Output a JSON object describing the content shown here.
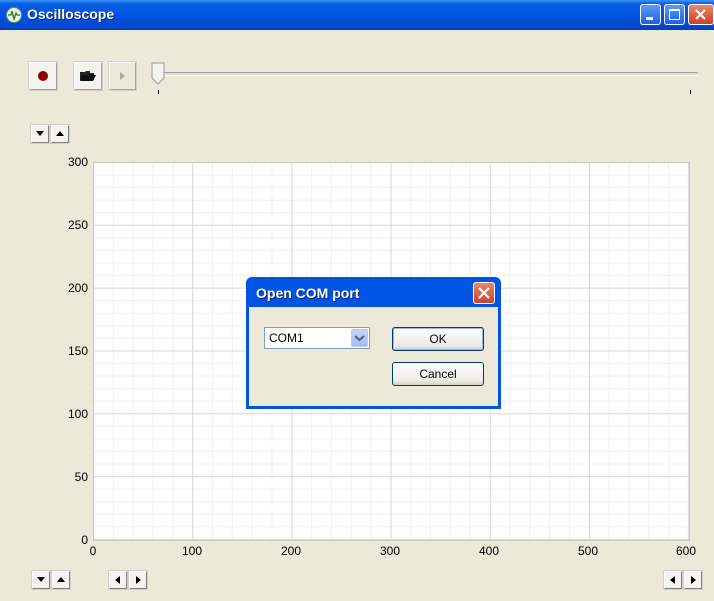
{
  "window": {
    "title": "Oscilloscope"
  },
  "toolbar": {
    "record_icon": "record-icon",
    "open_icon": "folder-open-icon",
    "play_icon": "play-icon",
    "slider_value": 0
  },
  "plot": {
    "y_ticks": [
      "300",
      "250",
      "200",
      "150",
      "100",
      "50",
      "0"
    ],
    "x_ticks": [
      "0",
      "100",
      "200",
      "300",
      "400",
      "500",
      "600"
    ]
  },
  "dialog": {
    "title": "Open COM port",
    "port_value": "COM1",
    "ok_label": "OK",
    "cancel_label": "Cancel"
  },
  "colors": {
    "titlebar": "#0054e3",
    "face": "#ece9d8",
    "record": "#8b0000"
  }
}
